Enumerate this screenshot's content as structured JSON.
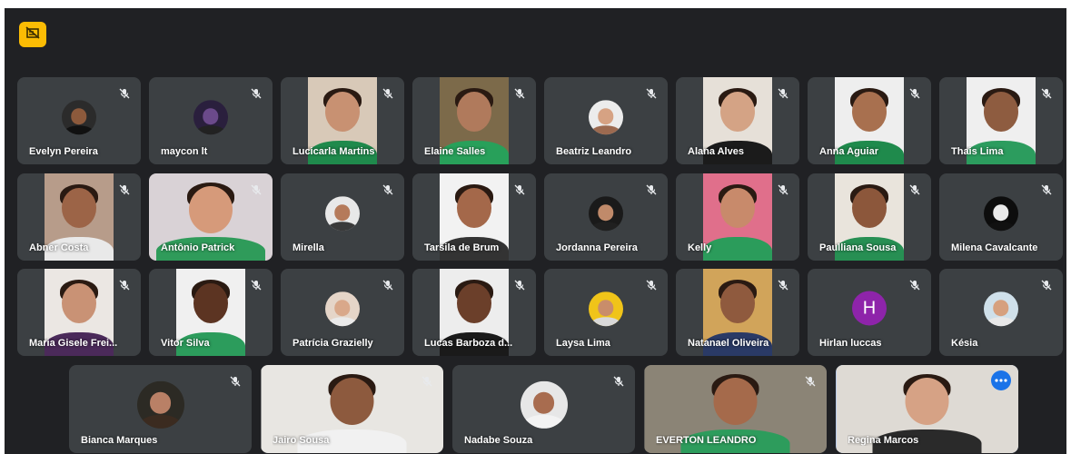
{
  "meeting": {
    "top_button_icon": "hand-raised-icon",
    "colors": {
      "background": "#202124",
      "tile": "#3c4043",
      "name_text": "#ffffff",
      "top_button": "#fbbc04",
      "speaking_outline": "#8ab4f8",
      "more_button": "#1a73e8"
    },
    "participants": [
      {
        "name": "Evelyn Pereira",
        "display": "avatar",
        "skin": "#8d5a3c",
        "bg": "#2b2b2b",
        "shirt": "#111111"
      },
      {
        "name": "maycon lt",
        "display": "avatar",
        "skin": "#6b4a8a",
        "bg": "#2a1f3d",
        "shirt": "#222222"
      },
      {
        "name": "Lucicarla Martins",
        "display": "video",
        "skin": "#c89172",
        "bg": "#d8c9b8",
        "shirt": "#1f8a4c"
      },
      {
        "name": "Elaine Salles",
        "display": "video",
        "skin": "#b07a5c",
        "bg": "#7c6a4a",
        "shirt": "#28a05a"
      },
      {
        "name": "Beatriz Leandro",
        "display": "avatar",
        "skin": "#d6a283",
        "bg": "#ececec",
        "shirt": "#9c6a50"
      },
      {
        "name": "Alana Alves",
        "display": "video",
        "skin": "#d4a385",
        "bg": "#e6e0d8",
        "shirt": "#1b1b1b"
      },
      {
        "name": "Anna Aguiar",
        "display": "video",
        "skin": "#a8704f",
        "bg": "#eeeeee",
        "shirt": "#1f8a4c"
      },
      {
        "name": "Thais Lima",
        "display": "video",
        "skin": "#8e5c40",
        "bg": "#efefef",
        "shirt": "#2c9c5e"
      },
      {
        "name": "Abner Costa",
        "display": "video",
        "skin": "#9c6447",
        "bg": "#b79c8a",
        "shirt": "#e9e9e9"
      },
      {
        "name": "Antônio Patrick",
        "display": "video-wide",
        "skin": "#d69a7a",
        "bg": "#d9d2d6",
        "shirt": "#2f9b5a"
      },
      {
        "name": "Mirella",
        "display": "avatar",
        "skin": "#b57a5a",
        "bg": "#e8e8e8",
        "shirt": "#3a3a3a"
      },
      {
        "name": "Tarsila de Brum",
        "display": "video",
        "skin": "#a4684a",
        "bg": "#f2f2f2",
        "shirt": "#333333"
      },
      {
        "name": "Jordanna Pereira",
        "display": "avatar",
        "skin": "#c08a6a",
        "bg": "#1a1a1a",
        "shirt": "#202020"
      },
      {
        "name": "Kelly",
        "display": "video",
        "skin": "#c88a6b",
        "bg": "#e06f8b",
        "shirt": "#2b9c5b"
      },
      {
        "name": "Paulliana Sousa",
        "display": "video",
        "skin": "#8c573b",
        "bg": "#e9e4dc",
        "shirt": "#278f53"
      },
      {
        "name": "Milena Cavalcante",
        "display": "avatar",
        "skin": "#eaeaea",
        "bg": "#0d0d0d",
        "shirt": "#111111"
      },
      {
        "name": "Maria Gisele Frei...",
        "display": "video",
        "skin": "#c99275",
        "bg": "#ebe7e3",
        "shirt": "#4b2a5a"
      },
      {
        "name": "Vitor Silva",
        "display": "video",
        "skin": "#5c3422",
        "bg": "#f0f0f0",
        "shirt": "#2c9c5c"
      },
      {
        "name": "Patrícia Grazielly",
        "display": "avatar",
        "skin": "#d9a88a",
        "bg": "#e5d5c8",
        "shirt": "#eaeaea"
      },
      {
        "name": "Lucas Barboza d...",
        "display": "video",
        "skin": "#6b3f2a",
        "bg": "#ededed",
        "shirt": "#1a1a1a"
      },
      {
        "name": "Laysa Lima",
        "display": "avatar",
        "skin": "#c98d6a",
        "bg": "#f0c419",
        "shirt": "#d9d9d9"
      },
      {
        "name": "Natanael Oliveira",
        "display": "video",
        "skin": "#8f5a3e",
        "bg": "#d1a45a",
        "shirt": "#2a3a66"
      },
      {
        "name": "Hirlan luccas",
        "display": "initial",
        "letter": "H",
        "color": "#8e24aa"
      },
      {
        "name": "Késia",
        "display": "avatar",
        "skin": "#d6a07e",
        "bg": "#cfe0ea",
        "shirt": "#e8e8e8"
      },
      {
        "name": "Bianca Marques",
        "display": "avatar",
        "skin": "#b98066",
        "bg": "#2c2a24",
        "shirt": "#3b2b20"
      },
      {
        "name": "Jairo Sousa",
        "display": "video-wide",
        "skin": "#8d5a3e",
        "bg": "#e8e6e2",
        "shirt": "#f1f1f1"
      },
      {
        "name": "Nadabe Souza",
        "display": "avatar",
        "skin": "#a86c4f",
        "bg": "#e7e7e7",
        "shirt": "#f3f3f3"
      },
      {
        "name": "EVERTON LEANDRO",
        "display": "video-wide",
        "skin": "#a56a4b",
        "bg": "#8b8476",
        "shirt": "#2d9c5c"
      },
      {
        "name": "Regina Marcos",
        "display": "video-wide",
        "skin": "#d6a285",
        "bg": "#dedad4",
        "shirt": "#2a2a2a",
        "highlight": true
      }
    ]
  }
}
